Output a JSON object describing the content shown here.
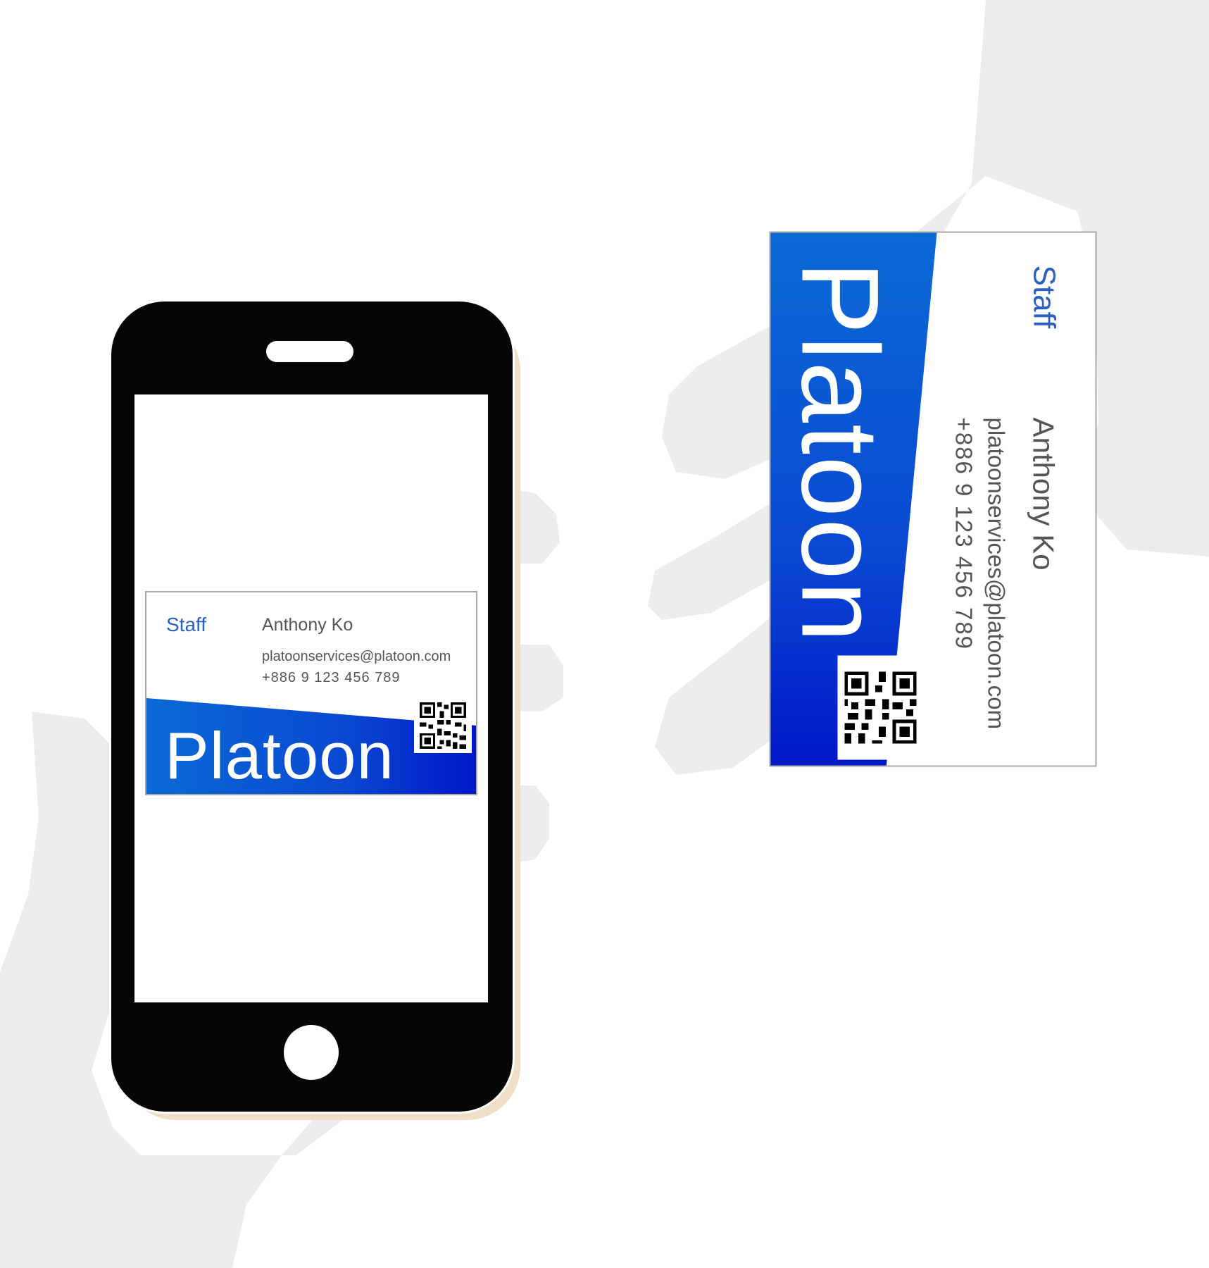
{
  "colors": {
    "card_band_start": "#0a6ad6",
    "card_band_end": "#0016c8",
    "role_text": "#2b5fc0",
    "body_text": "#555555",
    "phone_body": "#050505",
    "phone_shadow": "#eedfc6",
    "hand_silhouette": "#ececec"
  },
  "icons": {
    "qr": "qr-code-icon",
    "home_button": "home-button-icon",
    "speaker": "speaker-grille-icon"
  },
  "phone_card": {
    "role": "Staff",
    "name": "Anthony Ko",
    "email": "platoonservices@platoon.com",
    "phone": "+886 9 123 456 789",
    "logo": "Platoon"
  },
  "paper_card": {
    "role": "Staff",
    "name": "Anthony Ko",
    "email": "platoonservices@platoon.com",
    "phone": "+886 9 123 456 789",
    "logo": "Platoon"
  }
}
